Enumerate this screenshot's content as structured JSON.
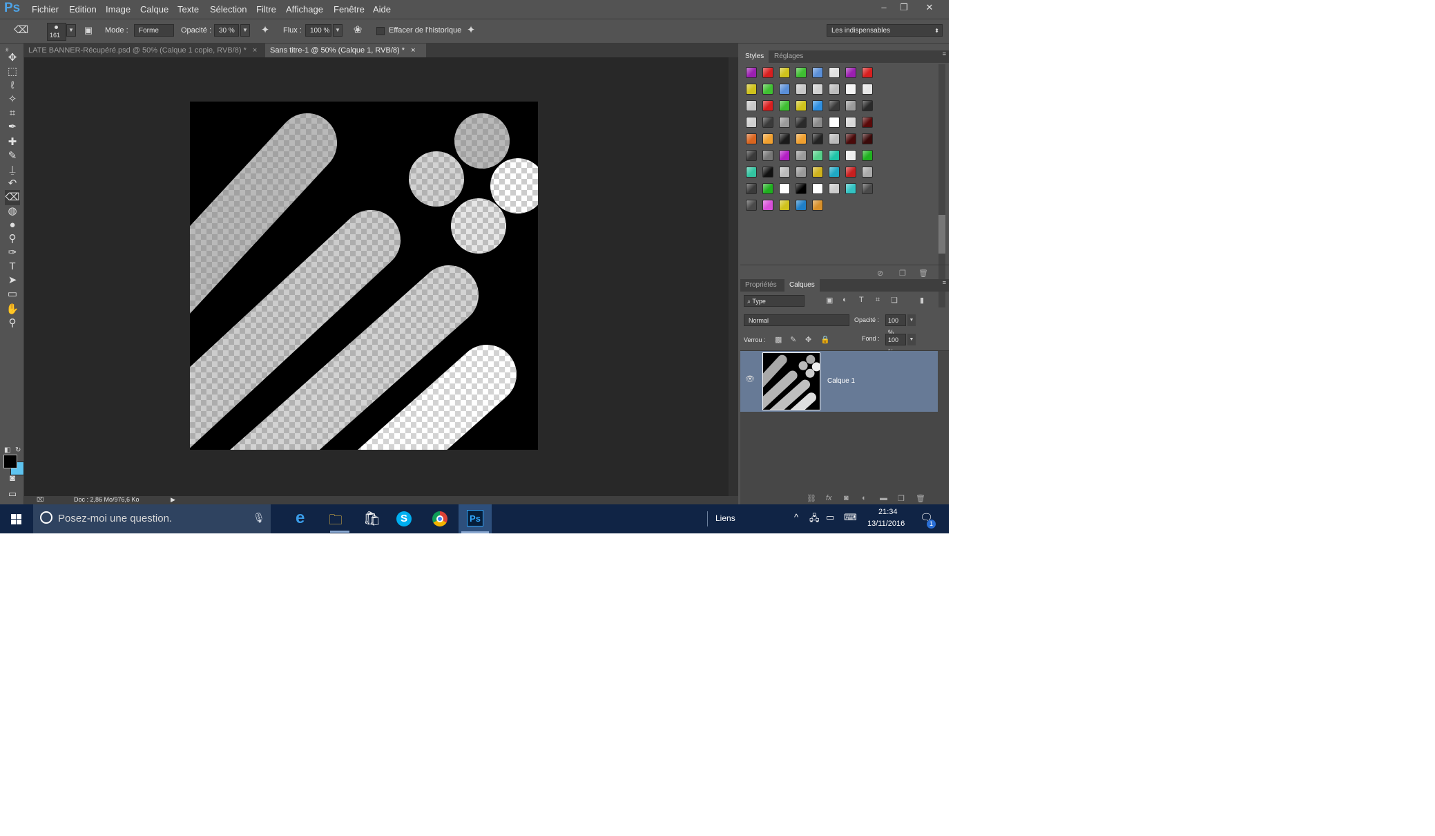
{
  "app": {
    "logo": "Ps"
  },
  "menu": [
    "Fichier",
    "Edition",
    "Image",
    "Calque",
    "Texte",
    "Sélection",
    "Filtre",
    "Affichage",
    "Fenêtre",
    "Aide"
  ],
  "window_buttons": [
    "–",
    "❐",
    "✕"
  ],
  "options": {
    "brush_size": "161",
    "mode_label": "Mode :",
    "mode_value": "Forme",
    "opacity_label": "Opacité :",
    "opacity_value": "30 %",
    "flux_label": "Flux :",
    "flux_value": "100 %",
    "history_label": "Effacer de l'historique",
    "workspace_value": "Les indispensables"
  },
  "tabs": [
    {
      "label": "LATE BANNER-Récupéré.psd @ 50% (Calque 1 copie, RVB/8) *",
      "close": "×",
      "active": false
    },
    {
      "label": "Sans titre-1 @ 50% (Calque 1, RVB/8) *",
      "close": "×",
      "active": true
    }
  ],
  "tools": [
    "move-icon",
    "marquee-icon",
    "lasso-icon",
    "magic-wand-icon",
    "crop-icon",
    "eyedropper-icon",
    "healing-brush-icon",
    "brush-icon",
    "clone-stamp-icon",
    "history-brush-icon",
    "eraser-icon",
    "paint-bucket-icon",
    "blur-icon",
    "dodge-icon",
    "pen-icon",
    "type-icon",
    "path-selection-icon",
    "rectangle-icon",
    "hand-icon",
    "zoom-icon"
  ],
  "status": {
    "doc": "Doc : 2,86 Mo/976,6 Ko"
  },
  "styles_panel": {
    "tabs": [
      "Styles",
      "Réglages"
    ],
    "swatches": [
      [
        "#9b1fb0",
        "#d81f1f",
        "#cfc21c",
        "#3fbf32",
        "#5a8fd8",
        "#e0e0e0",
        "#9b1fb0",
        "#d81f1f"
      ],
      [
        "#cfc21c",
        "#3fbf32",
        "#5a8fd8",
        "#c8c8c8",
        "#d0d0d0",
        "#bdbdbd",
        "#f4f4f4",
        "#e6e6e6"
      ],
      [
        "#c8c8c8",
        "#d81f1f",
        "#3fbf32",
        "#cfc21c",
        "#2f8fe0",
        "#3a3a3a",
        "#9a9a9a",
        "#2a2a2a"
      ],
      [
        "#cfcfcf",
        "#3a3a3a",
        "#9a9a9a",
        "#2a2a2a",
        "#8a8a8a",
        "#ffffff",
        "#d8d8d8",
        "#5a0a0a"
      ],
      [
        "#d9651f",
        "#f0a030",
        "#1a1a1a",
        "#f0a030",
        "#222222",
        "#bbbbbb",
        "#4a0a0a",
        "#3a0a0a"
      ],
      [
        "#3a3a3a",
        "#777777",
        "#b31fc4",
        "#9a9a9a",
        "#56d08a",
        "#1fc4a8",
        "#eeeeee",
        "#1fb01f"
      ],
      [
        "#33c3a0",
        "#111111",
        "#bbbbbb",
        "#9a9a9a",
        "#cfb21c",
        "#1fa8c4",
        "#c81f1f",
        "#aaaaaa"
      ],
      [
        "#3a3a3a",
        "#1fb01f",
        "#ffffff",
        "#000000",
        "#ffffff",
        "#cccccc",
        "#33c3c3",
        "#4a4a4a"
      ],
      [
        "#4a4a4a",
        "#d84fd8",
        "#cfc21c",
        "#1f7fc8",
        "#d8902a"
      ]
    ]
  },
  "layers_panel": {
    "tabs": [
      "Propriétés",
      "Calques"
    ],
    "filter": "Type",
    "blend_mode": "Normal",
    "opacity_label": "Opacité :",
    "opacity_value": "100 %",
    "lock_label": "Verrou :",
    "fill_label": "Fond :",
    "fill_value": "100 %",
    "layer_name": "Calque 1"
  },
  "taskbar": {
    "search_placeholder": "Posez-moi une question.",
    "links_label": "Liens",
    "time": "21:34",
    "date": "13/11/2016",
    "notification_count": "1",
    "ps_label": "Ps"
  }
}
